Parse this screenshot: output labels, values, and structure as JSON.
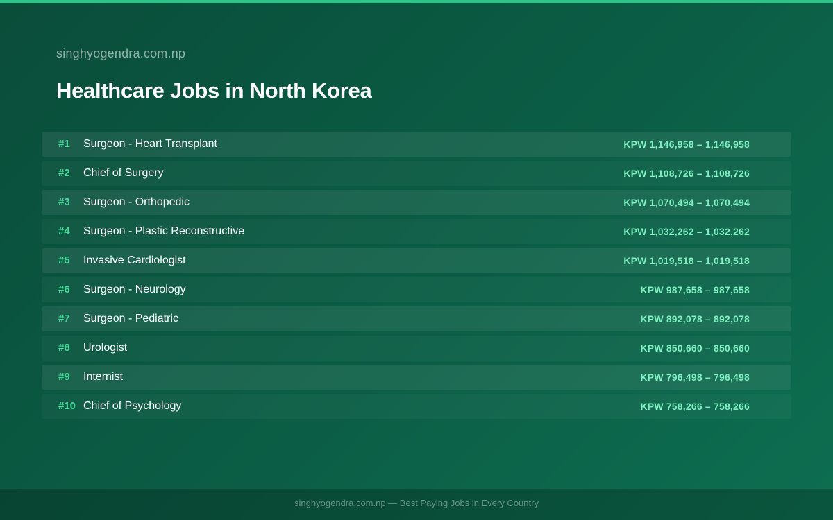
{
  "header": {
    "site_name": "singhyogendra.com.np",
    "title": "Healthcare Jobs in North Korea"
  },
  "jobs": [
    {
      "rank": "#1",
      "title": "Surgeon - Heart Transplant",
      "salary": "KPW 1,146,958 – 1,146,958"
    },
    {
      "rank": "#2",
      "title": "Chief of Surgery",
      "salary": "KPW 1,108,726 – 1,108,726"
    },
    {
      "rank": "#3",
      "title": "Surgeon - Orthopedic",
      "salary": "KPW 1,070,494 – 1,070,494"
    },
    {
      "rank": "#4",
      "title": "Surgeon - Plastic Reconstructive",
      "salary": "KPW 1,032,262 – 1,032,262"
    },
    {
      "rank": "#5",
      "title": "Invasive Cardiologist",
      "salary": "KPW 1,019,518 – 1,019,518"
    },
    {
      "rank": "#6",
      "title": "Surgeon - Neurology",
      "salary": "KPW 987,658 – 987,658"
    },
    {
      "rank": "#7",
      "title": "Surgeon - Pediatric",
      "salary": "KPW 892,078 – 892,078"
    },
    {
      "rank": "#8",
      "title": "Urologist",
      "salary": "KPW 850,660 – 850,660"
    },
    {
      "rank": "#9",
      "title": "Internist",
      "salary": "KPW 796,498 – 796,498"
    },
    {
      "rank": "#10",
      "title": "Chief of Psychology",
      "salary": "KPW 758,266 – 758,266"
    }
  ],
  "footer": {
    "text": "singhyogendra.com.np — Best Paying Jobs in Every Country"
  },
  "colors": {
    "accent": "#2fc38a",
    "rank": "#45d99a",
    "salary": "#7ff0c2",
    "background": "#0b5e45"
  }
}
